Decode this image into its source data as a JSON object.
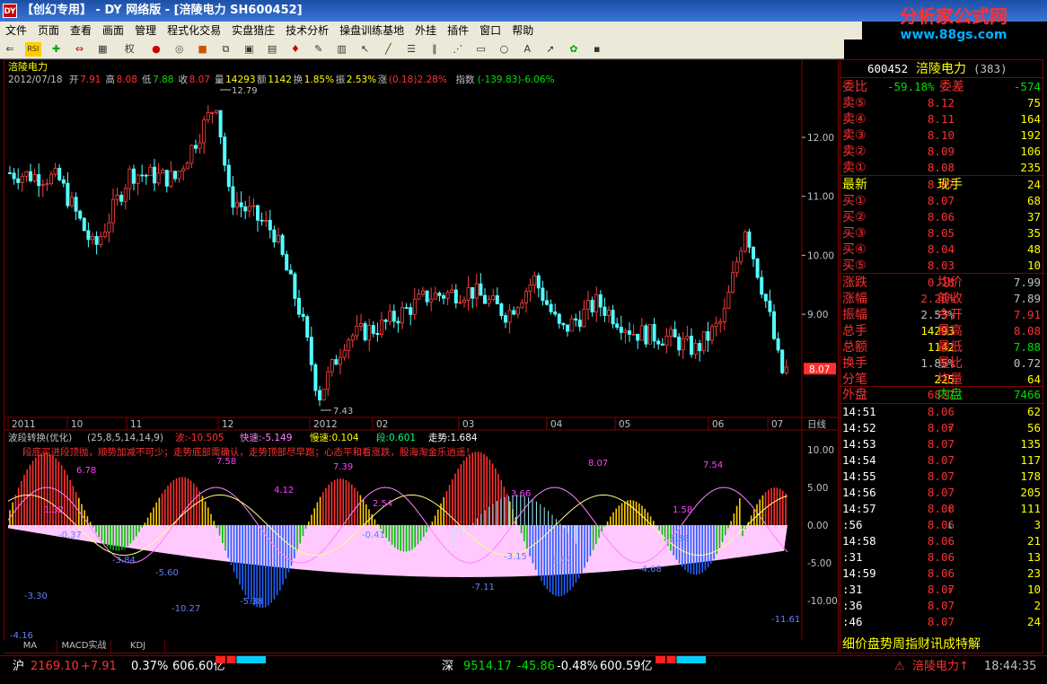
{
  "window": {
    "title": "【创幻专用】 - DY 网络版 - [涪陵电力 SH600452]",
    "app_icon": "app-icon"
  },
  "logo": {
    "text": "分析家公式网",
    "url": "www.88gs.com"
  },
  "menu": [
    "文件",
    "页面",
    "查看",
    "画面",
    "管理",
    "程式化交易",
    "实盘猎庄",
    "技术分析",
    "操盘训练基地",
    "外挂",
    "插件",
    "窗口",
    "帮助"
  ],
  "toolbar_icons": [
    "back-icon",
    "rsi-icon",
    "crosshair-icon",
    "exchange-icon",
    "right-icon",
    "grid-icon",
    "ball-red-icon",
    "ball-icon",
    "cube-icon",
    "k-icon",
    "bell-icon",
    "pen-icon",
    "window-icon",
    "tile-icon",
    "chart-icon",
    "cursor-icon",
    "line-icon",
    "ray-icon",
    "parallel-icon",
    "fan-icon",
    "rect-icon",
    "circle-icon",
    "text-icon",
    "arrow-icon",
    "color-icon",
    "save-icon"
  ],
  "toolbar_labels": {
    "rsi": "RSI",
    "right": "权"
  },
  "chart": {
    "stock_name": "涪陵电力",
    "info": {
      "date": "2012/07/18",
      "open_label": "开",
      "open": "7.91",
      "high_label": "高",
      "high": "8.08",
      "low_label": "低",
      "low": "7.88",
      "close_label": "收",
      "close": "8.07",
      "vol_label": "量",
      "vol": "14293",
      "amt_label": "额",
      "amt": "1142",
      "turn_label": "换",
      "turn": "1.85%",
      "amp_label": "振",
      "amp": "2.53%",
      "chg_label": "涨",
      "chg": "(0.18)2.28%",
      "idx_label": "指数",
      "idx": "(-139.83)-6.06%"
    },
    "price_axis": [
      "12.00",
      "11.00",
      "10.00",
      "9.00"
    ],
    "current_price": "8.07",
    "high_mark": "12.79",
    "low_mark": "7.43",
    "time_axis": [
      "2011",
      "10",
      "11",
      "12",
      "2012",
      "02",
      "03",
      "04",
      "05",
      "06",
      "07"
    ],
    "period": "日线",
    "indicator": {
      "title": "波段转换(优化)",
      "params": "(25,8,5,14,14,9)",
      "wave": "波:-10.505",
      "fast": "快速:-5.149",
      "slow": "慢速:0.104",
      "seg": "段:0.601",
      "trend": "走势:1.684",
      "tip": "段底买进段顶抛，顺势加减不可少；走势底部需确认，走势顶部尽早跑；心态平和看涨跌，股海淘金乐逍遥！",
      "axis": [
        "10.00",
        "5.00",
        "0.00",
        "-5.00",
        "-10.00"
      ],
      "labels": [
        "1.32",
        "6.78",
        "-0.37",
        "-5.60",
        "-10.27",
        "7.58",
        "-5.38",
        "4.12",
        "7.39",
        "-0.41",
        "2.54",
        "-7.11",
        "-3.15",
        "-3.66",
        "3.66",
        "8.07",
        "-3.28",
        "-4.68",
        "1.58",
        "7.54",
        "-11.61",
        "-3.30",
        "-3.84",
        "-4.16"
      ]
    },
    "bottom_tabs": [
      "MA",
      "MACD实战",
      "KDJ"
    ]
  },
  "quote": {
    "code": "600452",
    "name": "涪陵电力",
    "seq": "(383)",
    "webi_label": "委比",
    "webi": "-59.18%",
    "weicha_label": "委差",
    "weicha": "-574",
    "sell": [
      {
        "label": "卖⑤",
        "price": "8.12",
        "vol": "75"
      },
      {
        "label": "卖④",
        "price": "8.11",
        "vol": "164"
      },
      {
        "label": "卖③",
        "price": "8.10",
        "vol": "192"
      },
      {
        "label": "卖②",
        "price": "8.09",
        "vol": "106"
      },
      {
        "label": "卖①",
        "price": "8.08",
        "vol": "235"
      }
    ],
    "last_label": "最新",
    "last": "8.07",
    "xianshou_label": "现手",
    "xianshou": "24",
    "buy": [
      {
        "label": "买①",
        "price": "8.07",
        "vol": "68"
      },
      {
        "label": "买②",
        "price": "8.06",
        "vol": "37"
      },
      {
        "label": "买③",
        "price": "8.05",
        "vol": "35"
      },
      {
        "label": "买④",
        "price": "8.04",
        "vol": "48"
      },
      {
        "label": "买⑤",
        "price": "8.03",
        "vol": "10"
      }
    ],
    "stats": [
      {
        "l1": "涨跌",
        "v1": "0.18",
        "l2": "均价",
        "v2": "7.99"
      },
      {
        "l1": "涨幅",
        "v1": "2.28%",
        "l2": "前收",
        "v2": "7.89"
      },
      {
        "l1": "振幅",
        "v1": "2.53%",
        "l2": "今开",
        "v2": "7.91"
      },
      {
        "l1": "总手",
        "v1": "14293",
        "l2": "最高",
        "v2": "8.08"
      },
      {
        "l1": "总额",
        "v1": "1142",
        "l2": "最低",
        "v2": "7.88"
      },
      {
        "l1": "换手",
        "v1": "1.85%",
        "l2": "量比",
        "v2": "0.72"
      },
      {
        "l1": "分笔",
        "v1": "225",
        "l2": "均量",
        "v2": "64"
      }
    ],
    "waipan_label": "外盘",
    "waipan": "6827",
    "neipan_label": "内盘",
    "neipan": "7466",
    "ticks": [
      {
        "t": "14:51",
        "p": "8.06",
        "a": "",
        "v": "62"
      },
      {
        "t": "14:52",
        "p": "8.07",
        "a": "↑",
        "v": "56"
      },
      {
        "t": "14:53",
        "p": "8.07",
        "a": "",
        "v": "135"
      },
      {
        "t": "14:54",
        "p": "8.07",
        "a": "",
        "v": "117"
      },
      {
        "t": "14:55",
        "p": "8.07",
        "a": "",
        "v": "178"
      },
      {
        "t": "14:56",
        "p": "8.07",
        "a": "",
        "v": "205"
      },
      {
        "t": "14:57",
        "p": "8.08",
        "a": "↑",
        "v": "111"
      },
      {
        "t": ":56",
        "p": "8.06",
        "a": "↓",
        "v": "3"
      },
      {
        "t": "14:58",
        "p": "8.06",
        "a": "",
        "v": "21"
      },
      {
        "t": ":31",
        "p": "8.06",
        "a": "",
        "v": "13"
      },
      {
        "t": "14:59",
        "p": "8.06",
        "a": "",
        "v": "23"
      },
      {
        "t": ":31",
        "p": "8.07",
        "a": "↑",
        "v": "10"
      },
      {
        "t": ":36",
        "p": "8.07",
        "a": "",
        "v": "2"
      },
      {
        "t": ":46",
        "p": "8.07",
        "a": "",
        "v": "24"
      }
    ],
    "bottom_tabs": "细价盘势周指财讯成特解"
  },
  "status": {
    "sh_label": "沪",
    "sh_index": "2169.10",
    "sh_chg": "+7.91",
    "sh_pct": "0.37%",
    "sh_amt": "606.60亿",
    "sz_label": "深",
    "sz_index": "9514.17",
    "sz_chg": "-45.86",
    "sz_pct": "-0.48%",
    "sz_amt": "600.59亿",
    "stock": "涪陵电力",
    "time": "18:44:35"
  }
}
